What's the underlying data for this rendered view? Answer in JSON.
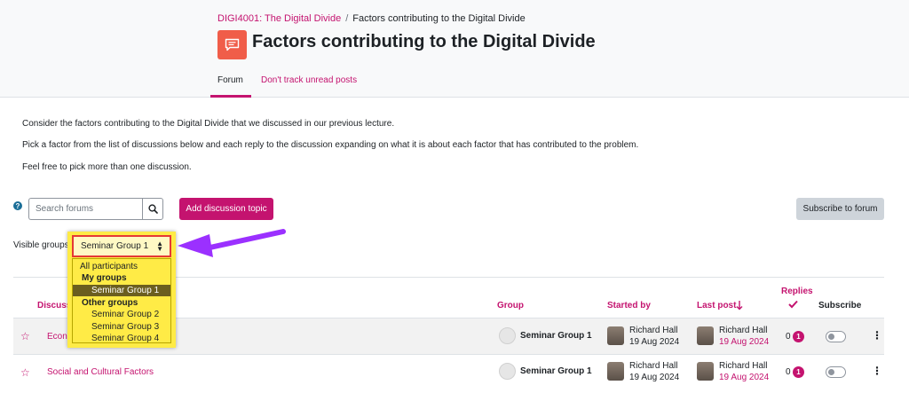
{
  "breadcrumb": {
    "course": "DIGI4001: The Digital Divide",
    "separator": "/",
    "current": "Factors contributing to the Digital Divide"
  },
  "page": {
    "title": "Factors contributing to the Digital Divide",
    "icon": "forum-icon"
  },
  "tabs": [
    {
      "label": "Forum",
      "active": true
    },
    {
      "label": "Don't track unread posts",
      "active": false
    }
  ],
  "intro": [
    "Consider the factors contributing to the Digital Divide that we discussed in our previous lecture.",
    "Pick a factor from the list of discussions below and each reply to the discussion expanding on what it is about each factor that has contributed to the problem.",
    "Feel free to pick more than one discussion."
  ],
  "toolbar": {
    "search_placeholder": "Search forums",
    "add_topic_label": "Add discussion topic",
    "subscribe_forum_label": "Subscribe to forum"
  },
  "groups": {
    "label": "Visible groups",
    "selected": "Seminar Group 1",
    "options": [
      {
        "label": "All participants",
        "type": "option"
      },
      {
        "label": "My groups",
        "type": "group"
      },
      {
        "label": "Seminar Group 1",
        "type": "option",
        "selected": true
      },
      {
        "label": "Other groups",
        "type": "group"
      },
      {
        "label": "Seminar Group 2",
        "type": "option"
      },
      {
        "label": "Seminar Group 3",
        "type": "option"
      },
      {
        "label": "Seminar Group 4",
        "type": "option"
      }
    ]
  },
  "table": {
    "headers": {
      "discussion": "Discussion",
      "group": "Group",
      "started_by": "Started by",
      "last_post": "Last post",
      "replies": "Replies",
      "subscribe": "Subscribe"
    },
    "rows": [
      {
        "title": "Econom",
        "group": "Seminar Group 1",
        "started_name": "Richard Hall",
        "started_date": "19 Aug 2024",
        "last_name": "Richard Hall",
        "last_date": "19 Aug 2024",
        "replies": "0",
        "unread": "1"
      },
      {
        "title": "Social and Cultural Factors",
        "group": "Seminar Group 1",
        "started_name": "Richard Hall",
        "started_date": "19 Aug 2024",
        "last_name": "Richard Hall",
        "last_date": "19 Aug 2024",
        "replies": "0",
        "unread": "1"
      }
    ]
  },
  "colors": {
    "accent": "#c4136f",
    "highlight": "#ffeb46",
    "arrow": "#9b30ff",
    "forum_icon": "#f05d49"
  }
}
